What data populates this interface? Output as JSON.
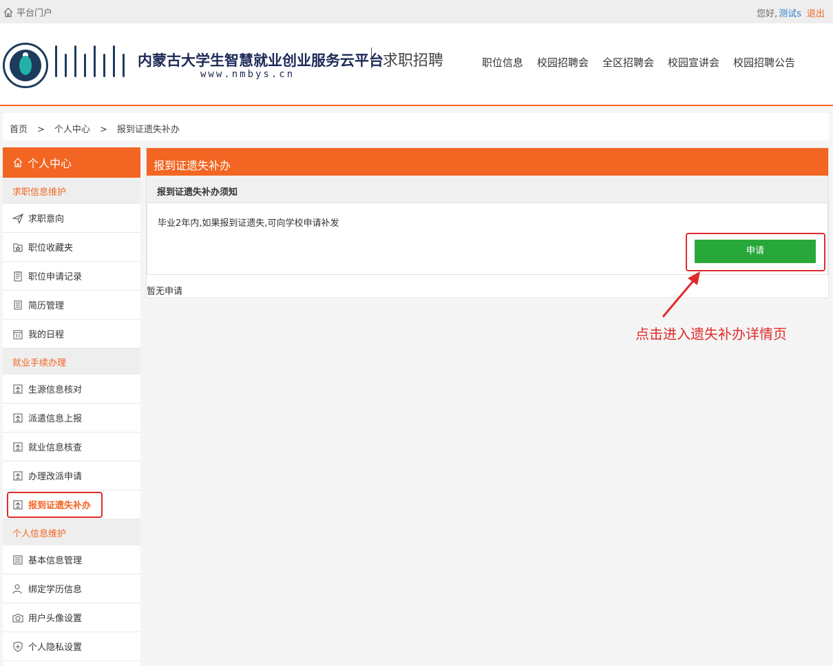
{
  "topbar": {
    "portal": "平台门户",
    "greeting": "您好,",
    "username": "测试s",
    "logout": "退出"
  },
  "header": {
    "brand": "内蒙古大学生智慧就业创业服务云平台",
    "url": "www.nmbys.cn",
    "subtitle": "求职招聘",
    "nav": [
      "职位信息",
      "校园招聘会",
      "全区招聘会",
      "校园宣讲会",
      "校园招聘公告"
    ]
  },
  "breadcrumb": {
    "items": [
      "首页",
      "个人中心",
      "报到证遗失补办"
    ],
    "sep": ">"
  },
  "sidebar": {
    "title": "个人中心",
    "sections": [
      {
        "label": "求职信息维护",
        "items": [
          "求职意向",
          "职位收藏夹",
          "职位申请记录",
          "简历管理",
          "我的日程"
        ]
      },
      {
        "label": "就业手续办理",
        "items": [
          "生源信息核对",
          "派遣信息上报",
          "就业信息核查",
          "办理改派申请",
          "报到证遗失补办"
        ]
      },
      {
        "label": "个人信息维护",
        "items": [
          "基本信息管理",
          "绑定学历信息",
          "用户头像设置",
          "个人隐私设置"
        ]
      }
    ]
  },
  "main": {
    "title": "报到证遗失补办",
    "notice_title": "报到证遗失补办须知",
    "notice_text": "毕业2年内,如果报到证遗失,可向学校申请补发",
    "apply_label": "申请",
    "empty": "暂无申请"
  },
  "annotation": "点击进入遗失补办详情页",
  "colors": {
    "accent": "#f26522",
    "apply": "#28a83a",
    "highlight": "#e12a2a"
  }
}
